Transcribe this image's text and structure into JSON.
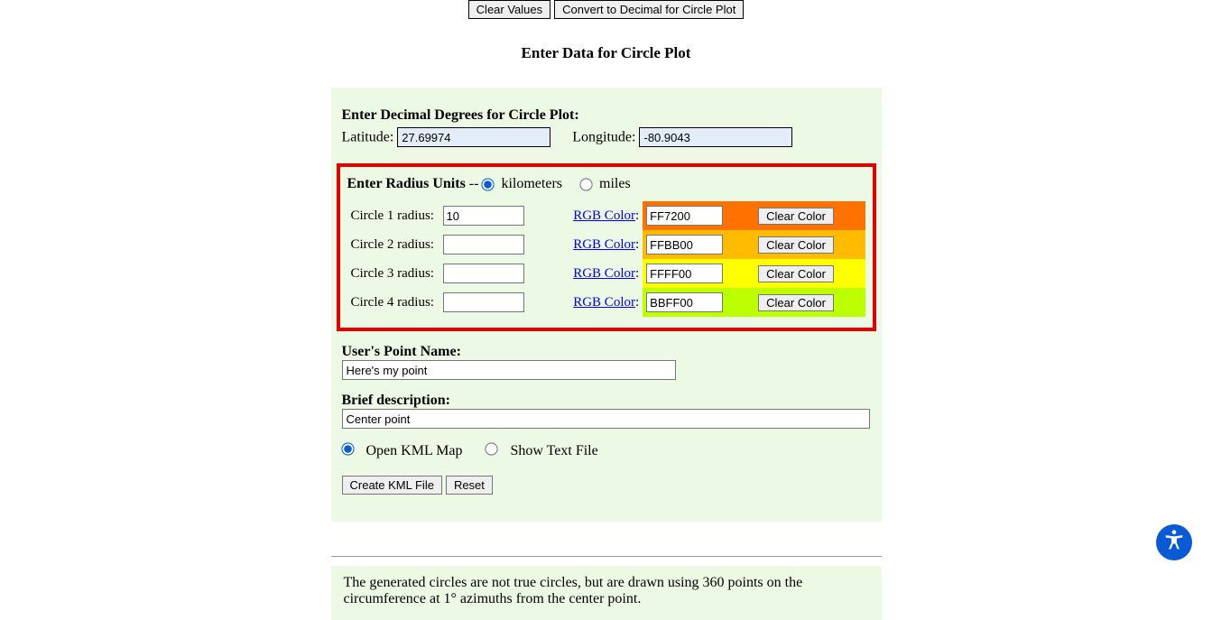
{
  "top_buttons": {
    "clear_values": "Clear Values",
    "convert_decimal": "Convert to Decimal for Circle Plot"
  },
  "heading": "Enter Data for Circle Plot",
  "decimal_section": {
    "title": "Enter Decimal Degrees for Circle Plot:",
    "latitude_label": "Latitude:",
    "latitude_value": "27.69974",
    "longitude_label": "Longitude:",
    "longitude_value": "-80.9043"
  },
  "units": {
    "title_prefix": "Enter Radius Units",
    "separator": " -- ",
    "km": "kilometers",
    "mi": "miles"
  },
  "rgb_link_text": "RGB Color",
  "clear_color_label": "Clear Color",
  "circles": [
    {
      "label": "Circle 1 radius:",
      "radius": "10",
      "rgb": "FF7200",
      "swatch": "#FF7200"
    },
    {
      "label": "Circle 2 radius:",
      "radius": "",
      "rgb": "FFBB00",
      "swatch": "#FFBB00"
    },
    {
      "label": "Circle 3 radius:",
      "radius": "",
      "rgb": "FFFF00",
      "swatch": "#FFFF00"
    },
    {
      "label": "Circle 4 radius:",
      "radius": "",
      "rgb": "BBFF00",
      "swatch": "#BBFF00"
    }
  ],
  "point_name": {
    "label": "User's Point Name:",
    "value": "Here's my point"
  },
  "description": {
    "label": "Brief description:",
    "value": "Center point"
  },
  "output": {
    "open_kml": "Open KML Map",
    "show_text": "Show Text File"
  },
  "actions": {
    "create_kml": "Create KML File",
    "reset": "Reset"
  },
  "note": "The generated circles are not true circles, but are drawn using 360 points on the circumference at 1° azimuths from the center point."
}
